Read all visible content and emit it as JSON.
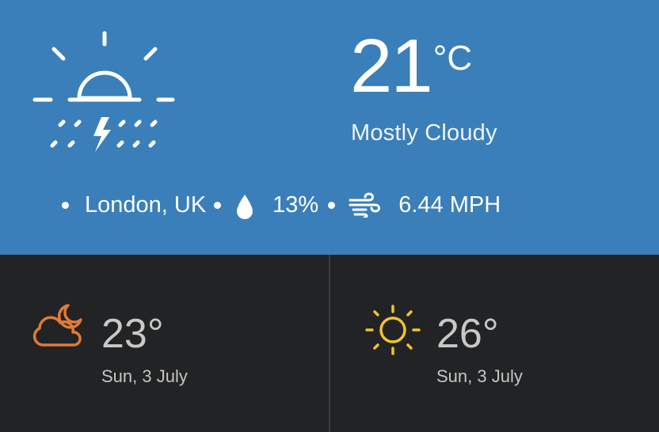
{
  "current": {
    "temperature": "21",
    "unit": "°C",
    "condition": "Mostly Cloudy",
    "icon": "sun-rain-thunder-icon"
  },
  "meta": {
    "location": "London, UK",
    "humidity": "13%",
    "wind": "6.44 MPH",
    "humidity_icon": "water-drop-icon",
    "wind_icon": "wind-icon"
  },
  "forecast": [
    {
      "temperature": "23°",
      "date": "Sun, 3 July",
      "icon": "cloud-moon-icon",
      "icon_color": "#e07b39"
    },
    {
      "temperature": "26°",
      "date": "Sun, 3 July",
      "icon": "sun-icon",
      "icon_color": "#f1c232"
    }
  ],
  "colors": {
    "top_background": "#3a7fb9",
    "bottom_background": "#222324"
  }
}
